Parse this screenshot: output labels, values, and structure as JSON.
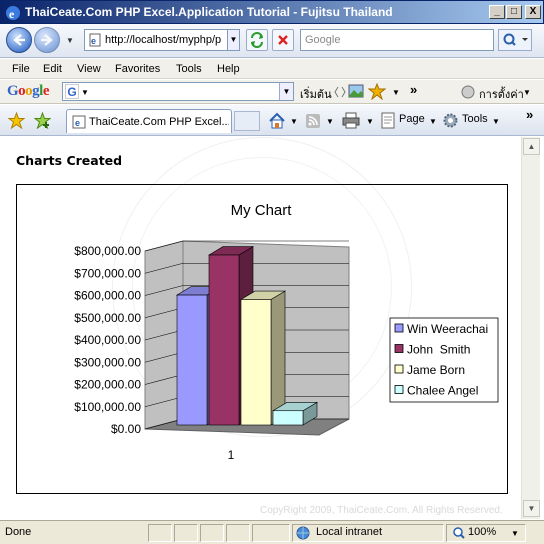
{
  "window": {
    "title": "ThaiCeate.Com PHP Excel.Application Tutorial - Fujitsu Thailand",
    "minimize": "_",
    "maximize": "□",
    "close": "X"
  },
  "address": {
    "url": "http://localhost/myphp/p",
    "search_placeholder": "Google"
  },
  "menu": [
    "File",
    "Edit",
    "View",
    "Favorites",
    "Tools",
    "Help"
  ],
  "google_toolbar": {
    "logo": "Google",
    "search_btn": "เริ่มต้น",
    "more": "»",
    "settings": "การตั้งค่า"
  },
  "tabbar": {
    "tab_label": "ThaiCeate.Com PHP Excel...",
    "page_label": "Page",
    "tools_label": "Tools",
    "more": "»"
  },
  "page": {
    "heading": "Charts Created",
    "copyright": "CopyRight 2009, ThaiCeate.Com. All Rights Reserved."
  },
  "status": {
    "text": "Done",
    "zone": "Local intranet",
    "zoom": "100%"
  },
  "chart_data": {
    "type": "bar",
    "title": "My Chart",
    "categories": [
      "1"
    ],
    "series": [
      {
        "name": "Win Weerachai",
        "values": [
          620000
        ],
        "color": "#9999ff"
      },
      {
        "name": "John  Smith",
        "values": [
          800000
        ],
        "color": "#993366"
      },
      {
        "name": "Jame Born",
        "values": [
          600000
        ],
        "color": "#ffffcc"
      },
      {
        "name": "Chalee Angel",
        "values": [
          100000
        ],
        "color": "#ccffff"
      }
    ],
    "ylim": [
      0,
      800000
    ],
    "yticks": [
      "$0.00",
      "$100,000.00",
      "$200,000.00",
      "$300,000.00",
      "$400,000.00",
      "$500,000.00",
      "$600,000.00",
      "$700,000.00",
      "$800,000.00"
    ],
    "grid": true,
    "legend": "right",
    "three_d": true
  }
}
